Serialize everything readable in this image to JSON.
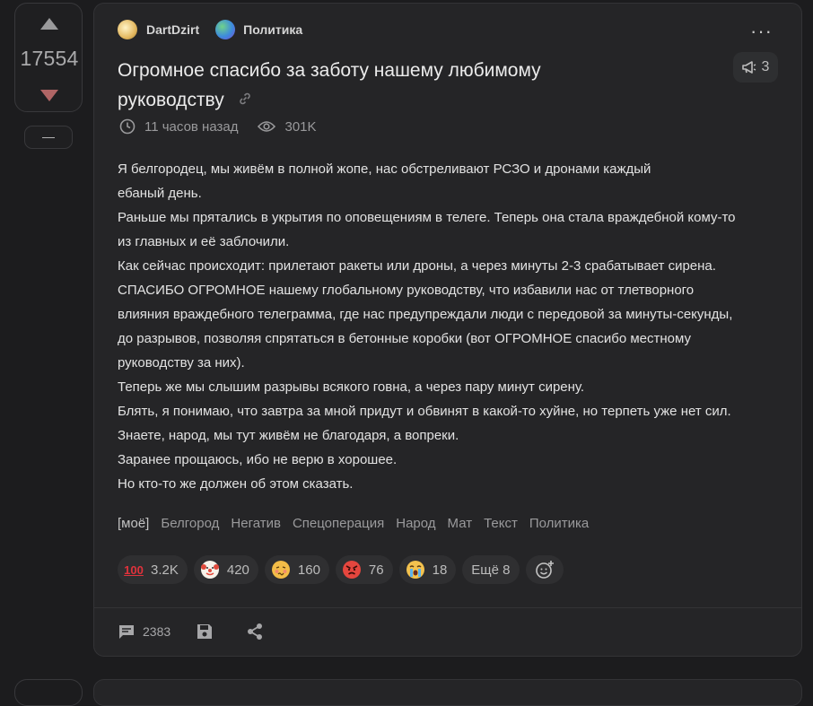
{
  "vote": {
    "count": "17554",
    "minus_label": "—"
  },
  "post": {
    "author": "DartDzirt",
    "community": "Политика",
    "title": "Огромное спасибо за заботу нашему любимому руководству",
    "time": "11 часов назад",
    "views": "301K",
    "story_count": "3",
    "body": [
      "Я белгородец, мы живём в полной жопе, нас обстреливают РСЗО и дронами каждый",
      "ебаный день.",
      "Раньше мы прятались в укрытия по оповещениям в телеге. Теперь она стала враждебной кому-то",
      "из главных и её заблочили.",
      "Как сейчас происходит: прилетают ракеты или дроны, а через минуты 2-3 срабатывает сирена.",
      "СПАСИБО ОГРОМНОЕ нашему глобальному руководству, что избавили нас от тлетворного",
      "влияния враждебного телеграмма, где нас предупреждали люди с передовой за минуты-секунды,",
      "до разрывов, позволяя спрятаться в бетонные коробки (вот ОГРОМНОЕ спасибо местному",
      "руководству за них).",
      "Теперь же мы слышим разрывы всякого говна, а через пару минут сирену.",
      "Блять, я понимаю, что завтра за мной придут и обвинят в какой-то хуйне, но терпеть уже нет сил.",
      "Знаете, народ, мы тут живём не благодаря, а вопреки.",
      "Заранее прощаюсь, ибо не верю в хорошее.",
      "Но кто-то же должен об этом сказать."
    ],
    "tags": [
      "[моё]",
      "Белгород",
      "Негатив",
      "Спецоперация",
      "Народ",
      "Мат",
      "Текст",
      "Политика"
    ],
    "reactions": [
      {
        "icon": "hundred-points-icon",
        "count": "3.2K",
        "color": "#e0323c"
      },
      {
        "icon": "clown-face-icon",
        "count": "420",
        "color": "#f2c14e"
      },
      {
        "icon": "woozy-face-icon",
        "count": "160",
        "color": "#f0b63f"
      },
      {
        "icon": "angry-face-icon",
        "count": "76",
        "color": "#e4463f"
      },
      {
        "icon": "crying-face-icon",
        "count": "18",
        "color": "#f2c14e"
      }
    ],
    "more_reactions": "Ещё 8",
    "comments": "2383"
  }
}
